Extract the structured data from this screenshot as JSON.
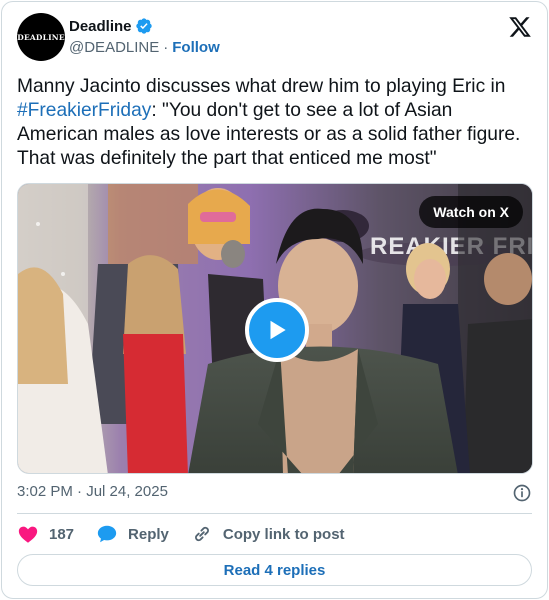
{
  "author": {
    "avatar_text": "DEADLINE",
    "display_name": "Deadline",
    "handle": "@DEADLINE",
    "separator": "·",
    "follow_label": "Follow"
  },
  "tweet": {
    "text_before": "Manny Jacinto discusses what drew him to playing Eric in ",
    "hashtag": "#FreakierFriday",
    "text_after": ": \"You don't get to see a lot of Asian American males as love interests or as a solid father figure. That was definitely the part that enticed me most\""
  },
  "media": {
    "watch_label": "Watch on X",
    "backdrop_text": "REAKIER FRIDA"
  },
  "timestamp": "3:02 PM · Jul 24, 2025",
  "actions": {
    "like_count": "187",
    "reply_label": "Reply",
    "copy_label": "Copy link to post"
  },
  "read_replies_label": "Read 4 replies",
  "colors": {
    "link": "#1d6fb8",
    "verified": "#1d9bf0",
    "like": "#f91880",
    "play": "#1d9bf0",
    "muted": "#536471",
    "border": "#cfd9de"
  },
  "icons": [
    "verified-badge-icon",
    "x-logo-icon",
    "play-icon",
    "info-icon",
    "heart-icon",
    "reply-bubble-icon",
    "link-icon"
  ]
}
